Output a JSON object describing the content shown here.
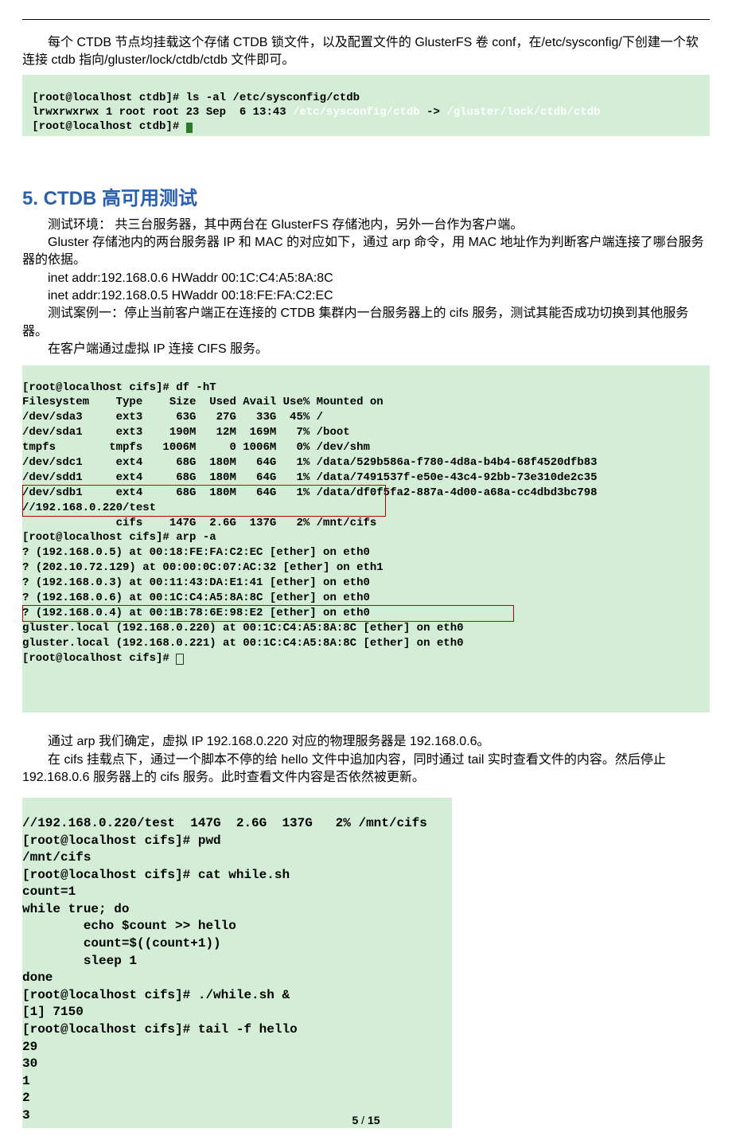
{
  "intro": {
    "p1": "每个 CTDB 节点均挂载这个存储 CTDB 锁文件，以及配置文件的 GlusterFS 卷 conf，在/etc/sysconfig/下创建一个软连接 ctdb 指向/gluster/lock/ctdb/ctdb 文件即可。"
  },
  "term1": {
    "line1a": "[root@localhost ctdb]# ls -al /etc/sysconfig/ctdb",
    "line2a": "lrwxrwxrwx 1 root root 23 Sep  6 13:43 ",
    "line2b": "/etc/sysconfig/ctdb",
    "line2c": " -> ",
    "line2d": "/gluster/lock/ctdb/ctdb",
    "line3a": "[root@localhost ctdb]# "
  },
  "heading5": "5.  CTDB 高可用测试",
  "sec5": {
    "p1": "测试环境：  共三台服务器，其中两台在 GlusterFS 存储池内，另外一台作为客户端。",
    "p2": "Gluster 存储池内的两台服务器 IP 和 MAC 的对应如下，通过 arp 命令，用 MAC 地址作为判断客户端连接了哪台服务器的依据。",
    "inet1": "inet addr:192.168.0.6   HWaddr 00:1C:C4:A5:8A:8C",
    "inet2": "inet addr:192.168.0.5   HWaddr 00:18:FE:FA:C2:EC",
    "p3": "测试案例一：停止当前客户端正在连接的 CTDB 集群内一台服务器上的 cifs 服务，测试其能否成功切换到其他服务器。",
    "p4": "在客户端通过虚拟 IP 连接 CIFS 服务。"
  },
  "term2": {
    "prompt_df": "[root@localhost cifs]# df -hT",
    "header": "Filesystem    Type    Size  Used Avail Use% Mounted on",
    "sda3": "/dev/sda3     ext3     63G   27G   33G  45% /",
    "sda1": "/dev/sda1     ext3    190M   12M  169M   7% /boot",
    "tmpfs": "tmpfs        tmpfs   1006M     0 1006M   0% /dev/shm",
    "sdc1": "/dev/sdc1     ext4     68G  180M   64G   1% /data/529b586a-f780-4d8a-b4b4-68f4520dfb83",
    "sdd1": "/dev/sdd1     ext4     68G  180M   64G   1% /data/7491537f-e50e-43c4-92bb-73e310de2c35",
    "sdb1": "/dev/sdb1     ext4     68G  180M   64G   1% /data/df0f5fa2-887a-4d00-a68a-cc4dbd3bc798",
    "cifs_path": "//192.168.0.220/test",
    "cifs_row": "              cifs    147G  2.6G  137G   2% /mnt/cifs",
    "prompt_arp": "[root@localhost cifs]# arp -a",
    "arp1": "? (192.168.0.5) at 00:18:FE:FA:C2:EC [ether] on eth0",
    "arp2": "? (202.10.72.129) at 00:00:0C:07:AC:32 [ether] on eth1",
    "arp3": "? (192.168.0.3) at 00:11:43:DA:E1:41 [ether] on eth0",
    "arp4": "? (192.168.0.6) at 00:1C:C4:A5:8A:8C [ether] on eth0",
    "arp5": "? (192.168.0.4) at 00:1B:78:6E:98:E2 [ether] on eth0",
    "gl1": "gluster.local (192.168.0.220) at 00:1C:C4:A5:8A:8C [ether] on eth0",
    "gl2": "gluster.local (192.168.0.221) at 00:1C:C4:A5:8A:8C [ether] on eth0",
    "prompt_end": "[root@localhost cifs]# "
  },
  "mid": {
    "p1": "通过 arp 我们确定，虚拟 IP 192.168.0.220 对应的物理服务器是 192.168.0.6。",
    "p2": "在 cifs 挂载点下，通过一个脚本不停的给 hello 文件中追加内容，同时通过 tail 实时查看文件的内容。然后停止 192.168.0.6 服务器上的 cifs 服务。此时查看文件内容是否依然被更新。"
  },
  "term3": {
    "row1": "//192.168.0.220/test  147G  2.6G  137G   2% /mnt/cifs",
    "pwd_p": "[root@localhost cifs]# pwd",
    "pwd_o": "/mnt/cifs",
    "cat": "[root@localhost cifs]# cat while.sh",
    "s1": "count=1",
    "s2": "while true; do",
    "s3": "        echo $count >> hello",
    "s4": "        count=$((count+1))",
    "s5": "        sleep 1",
    "s6": "done",
    "run_a": "[root@localhost cifs]# ",
    "run_b": "./while.sh &",
    "job": "[1] 7150",
    "tail_a": "[root@localhost cifs]# ",
    "tail_b": "tail -f hello",
    "n29": "29",
    "n30": "30",
    "n1": "1",
    "n2": "2",
    "n3": "3"
  },
  "pagefoot": {
    "current": "5",
    "sep": " / ",
    "total": "15"
  }
}
